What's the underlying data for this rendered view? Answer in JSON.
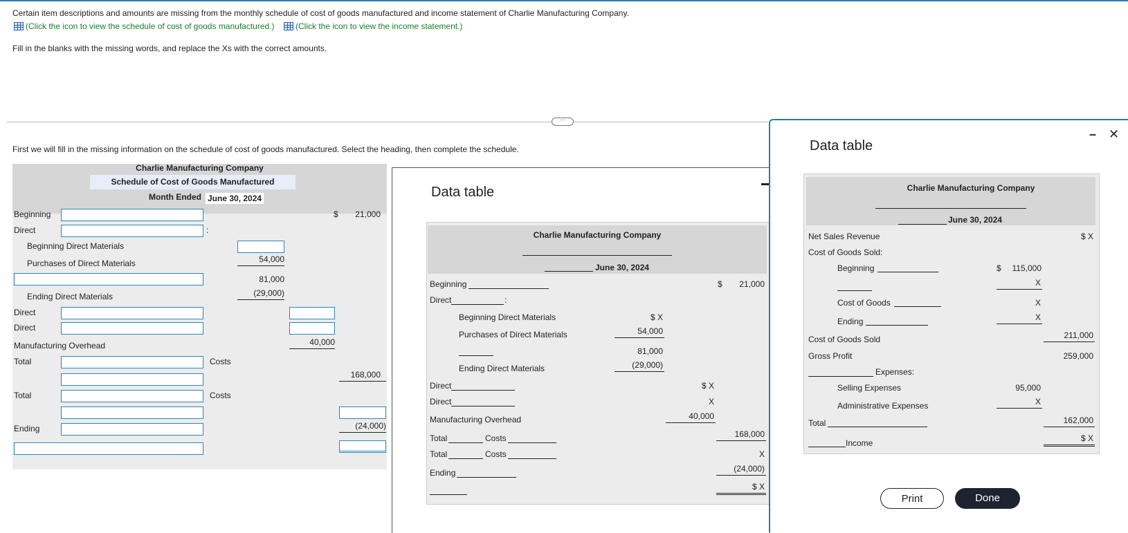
{
  "intro": {
    "line1": "Certain item descriptions and amounts are missing from the monthly schedule of cost of goods manufactured and income statement of Charlie Manufacturing Company.",
    "link1": "(Click the icon to view the schedule of cost of goods manufactured.)",
    "link2": "(Click the icon to view the income statement.)",
    "line2": "Fill in the blanks with the missing words, and replace the Xs with the correct amounts."
  },
  "instruction": "First we will fill in the missing information on the schedule of cost of goods manufactured. Select the heading, then complete the schedule.",
  "schedule": {
    "company": "Charlie Manufacturing Company",
    "title": "Schedule of Cost of Goods Manufactured",
    "period_prefix": "Month Ended",
    "period_date": "June 30, 2024",
    "labels": {
      "beginning": "Beginning",
      "direct": "Direct",
      "colon": ":",
      "bdm": "Beginning Direct Materials",
      "pdm": "Purchases of Direct Materials",
      "edm": "Ending Direct Materials",
      "direct2": "Direct",
      "direct3": "Direct",
      "mo": "Manufacturing Overhead",
      "total1": "Total",
      "costs1": "Costs",
      "total2": "Total",
      "costs2": "Costs",
      "ending": "Ending"
    },
    "amounts": {
      "dollar": "$",
      "beg": "21,000",
      "pdm": "54,000",
      "sum": "81,000",
      "edm": "(29,000)",
      "mo": "40,000",
      "total_costs": "168,000",
      "ending": "(24,000)"
    }
  },
  "data_table_1": {
    "title": "Data table",
    "company": "Charlie Manufacturing Company",
    "date": "June 30, 2024",
    "rows": {
      "beginning": "Beginning",
      "direct": "Direct",
      "colon": ":",
      "bdm": "Beginning Direct Materials",
      "pdm": "Purchases of Direct Materials",
      "edm": "Ending Direct Materials",
      "direct2": "Direct",
      "direct3": "Direct",
      "mo": "Manufacturing Overhead",
      "total1": "Total",
      "costs1": "Costs",
      "total2": "Total",
      "costs2": "Costs",
      "ending": "Ending"
    },
    "amounts": {
      "dollar": "$",
      "beg": "21,000",
      "bdm": "$ X",
      "pdm": "54,000",
      "sum": "81,000",
      "edm": "(29,000)",
      "d2": "$ X",
      "d3": "X",
      "mo": "40,000",
      "tc": "168,000",
      "x": "X",
      "end": "(24,000)",
      "final": "$ X"
    }
  },
  "data_table_2": {
    "title": "Data table",
    "company": "Charlie Manufacturing Company",
    "date": "June 30, 2024",
    "rows": {
      "nsr": "Net Sales Revenue",
      "cogs_label": "Cost of Goods Sold:",
      "beginning": "Beginning",
      "cog": "Cost of Goods",
      "ending": "Ending",
      "cogs": "Cost of Goods Sold",
      "gp": "Gross Profit",
      "expenses": "Expenses:",
      "selling": "Selling Expenses",
      "admin": "Administrative Expenses",
      "total": "Total",
      "income": "Income"
    },
    "amounts": {
      "nsr": "$ X",
      "dollar": "$",
      "beg": "115,000",
      "x1": "X",
      "x2": "X",
      "x3": "X",
      "cogs": "211,000",
      "gp": "259,000",
      "selling": "95,000",
      "admin": "X",
      "total": "162,000",
      "income": "$ X"
    },
    "buttons": {
      "print": "Print",
      "done": "Done"
    },
    "minimize": "–",
    "close": "✕"
  }
}
